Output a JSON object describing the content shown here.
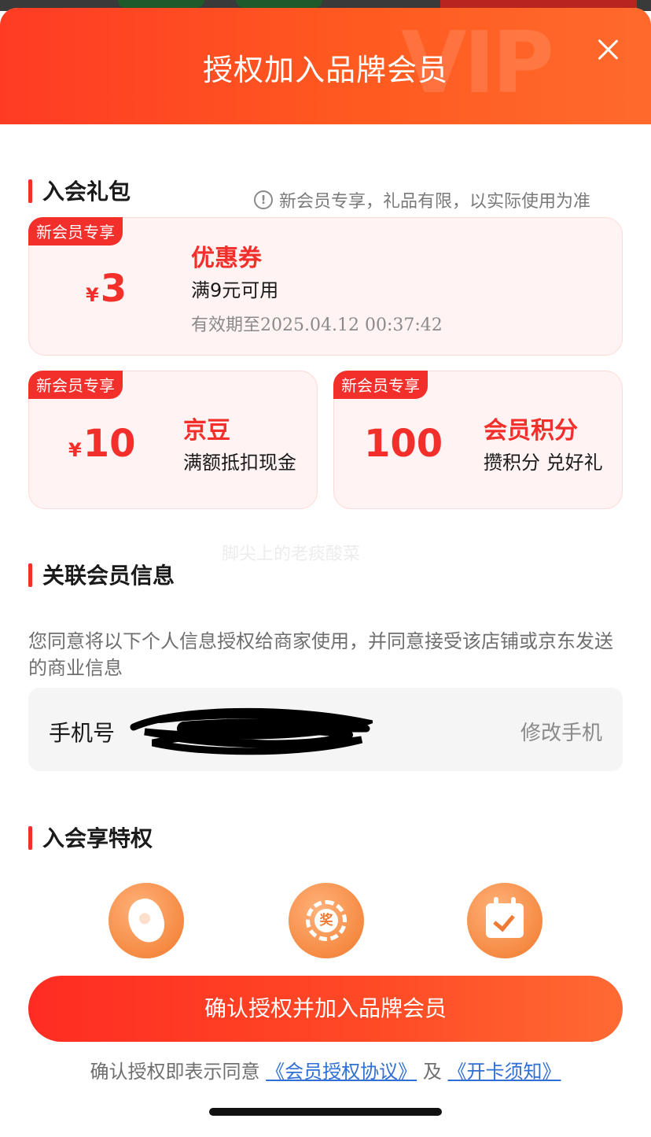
{
  "header": {
    "title": "授权加入品牌会员",
    "watermark": "VIP"
  },
  "gift": {
    "title": "入会礼包",
    "notice": "新会员专享，礼品有限，以实际使用为准",
    "coupon": {
      "tag": "新会员专享",
      "currency": "¥",
      "amount": "3",
      "name": "优惠券",
      "condition": "满9元可用",
      "validity": "有效期至2025.04.12 00:37:42"
    },
    "beans": {
      "tag": "新会员专享",
      "currency": "¥",
      "amount": "10",
      "name": "京豆",
      "desc": "满额抵扣现金"
    },
    "points": {
      "tag": "新会员专享",
      "amount": "100",
      "name": "会员积分",
      "desc": "攒积分 兑好礼"
    }
  },
  "watermark_text": "脚尖上的老痰酸菜",
  "member_info": {
    "title": "关联会员信息",
    "description": "您同意将以下个人信息授权给商家使用，并同意接受该店铺或京东发送的商业信息",
    "phone_label": "手机号",
    "edit_label": "修改手机"
  },
  "privileges": {
    "title": "入会享特权",
    "icons": [
      "bean-icon",
      "lottery-wheel-icon",
      "calendar-check-icon"
    ],
    "lottery_char": "奖"
  },
  "confirm_button": "确认授权并加入品牌会员",
  "agreement": {
    "prefix": "确认授权即表示同意",
    "link1": "《会员授权协议》",
    "joiner": "及",
    "link2": "《开卡须知》"
  },
  "colors": {
    "accent": "#f22f2a",
    "header_gradient_start": "#ff3b24",
    "link": "#2f6fd6"
  }
}
